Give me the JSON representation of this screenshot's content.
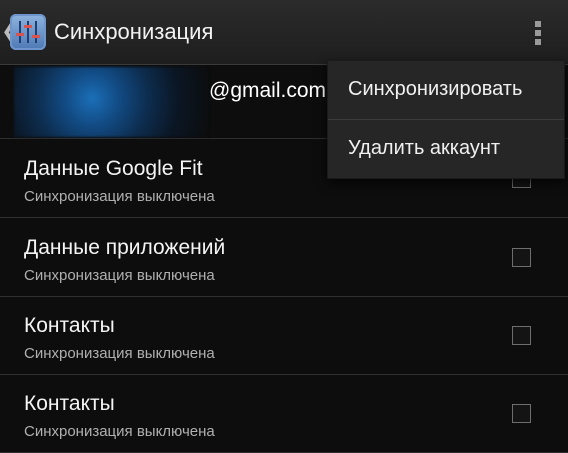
{
  "actionbar": {
    "back_glyph": "❮",
    "app_icon": "equalizer-settings-icon",
    "title": "Синхронизация",
    "overflow_icon": "overflow-menu-icon"
  },
  "account": {
    "email": "@gmail.com"
  },
  "sync_items": [
    {
      "title": "Данные Google Fit",
      "subtitle": "Синхронизация выключена",
      "checked": false
    },
    {
      "title": "Данные приложений",
      "subtitle": "Синхронизация выключена",
      "checked": false
    },
    {
      "title": "Контакты",
      "subtitle": "Синхронизация выключена",
      "checked": false
    },
    {
      "title": "Контакты",
      "subtitle": "Синхронизация выключена",
      "checked": false
    }
  ],
  "menu": {
    "items": [
      {
        "label": "Синхронизировать"
      },
      {
        "label": "Удалить аккаунт"
      }
    ]
  }
}
